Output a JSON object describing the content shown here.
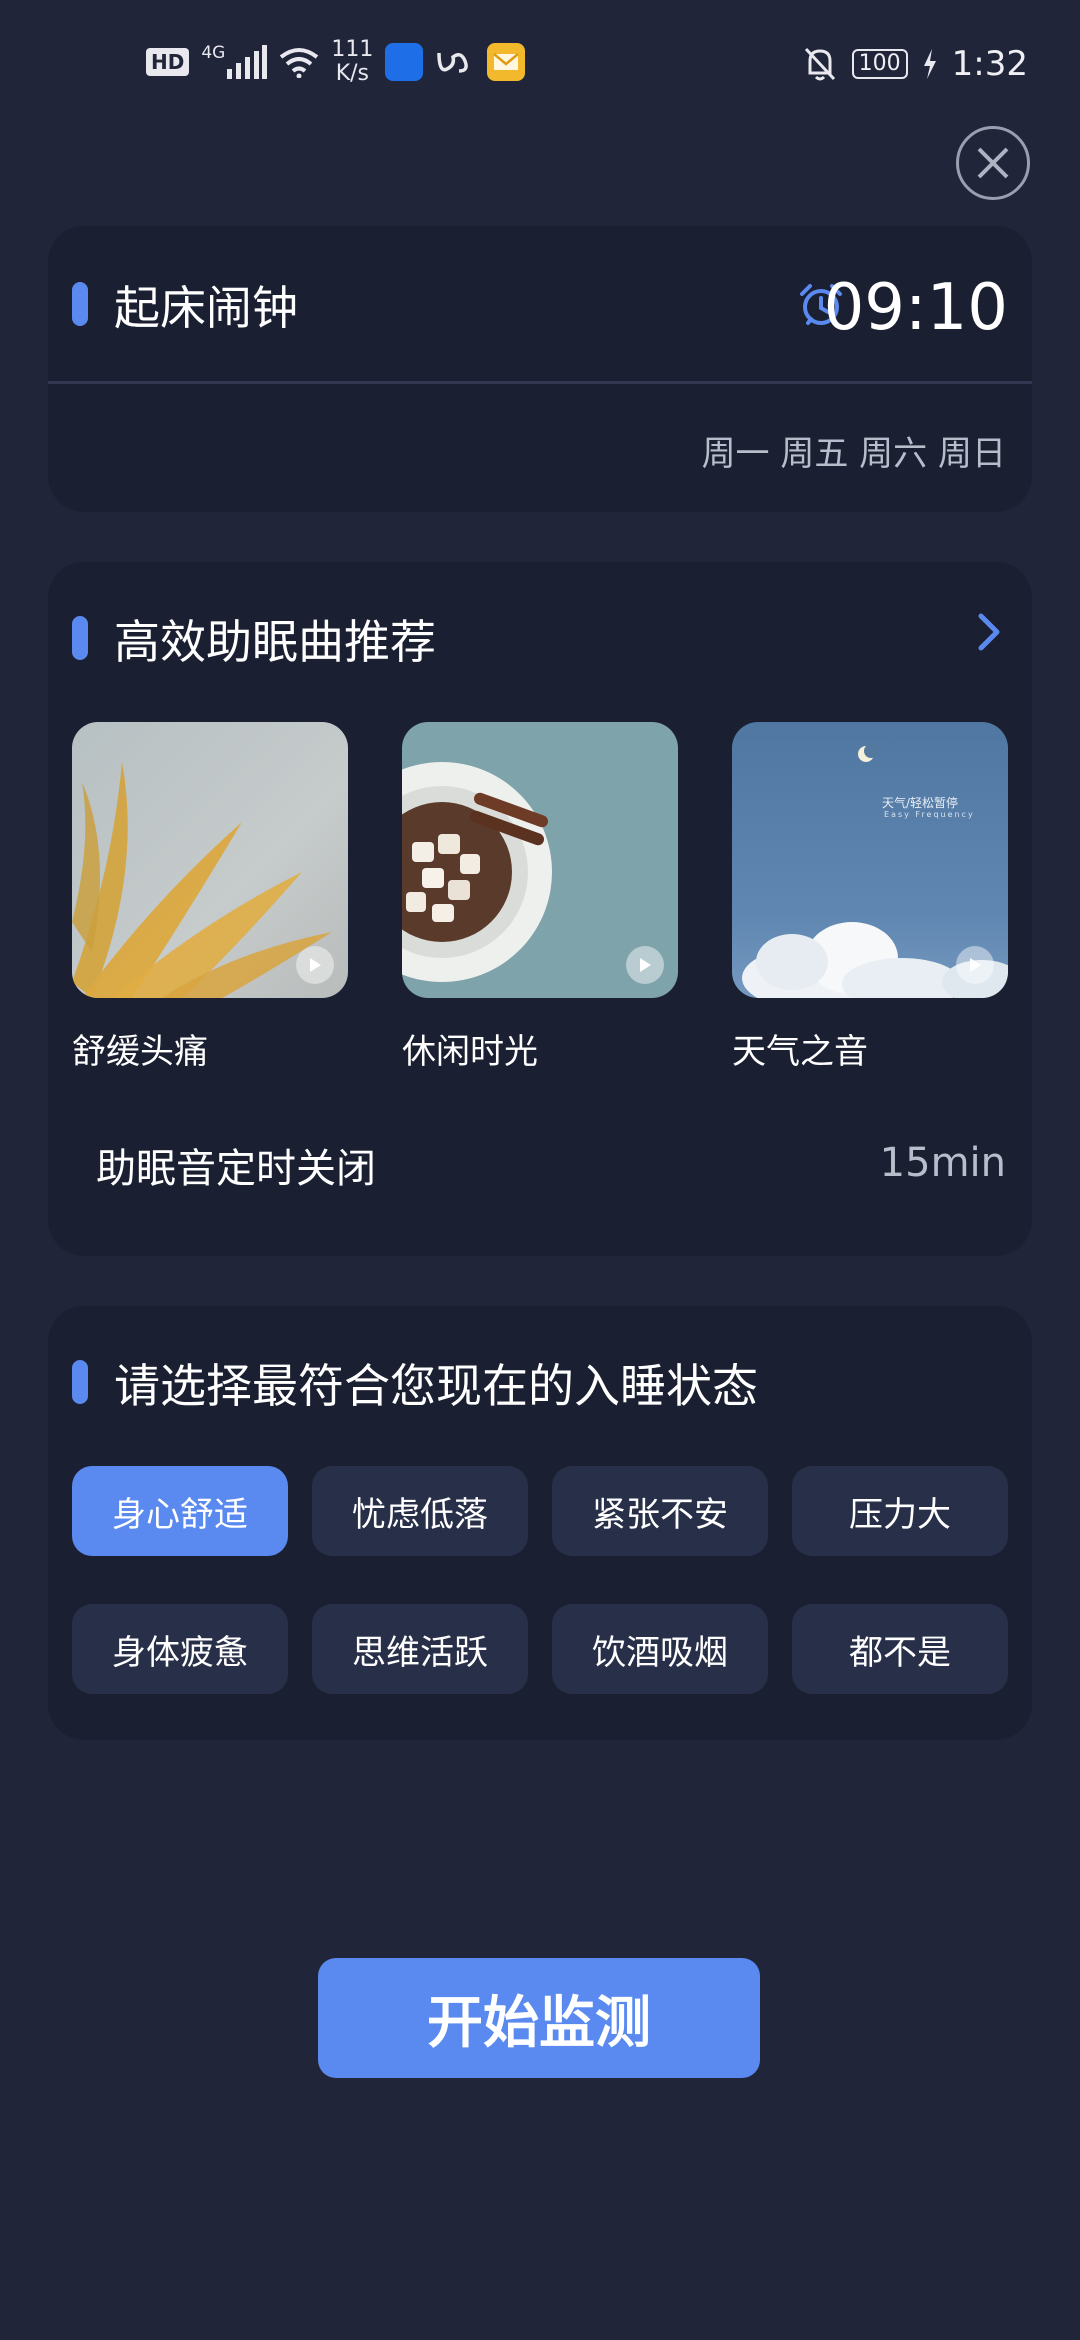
{
  "status_bar": {
    "hd": "HD",
    "network": "4G",
    "speed_value": "111",
    "speed_unit": "K/s",
    "battery": "100",
    "time": "1:32"
  },
  "alarm": {
    "title": "起床闹钟",
    "time": "09:10",
    "days": "周一 周五 周六 周日"
  },
  "music": {
    "title": "高效助眠曲推荐",
    "items": [
      {
        "label": "舒缓头痛"
      },
      {
        "label": "休闲时光"
      },
      {
        "label": "天气之音",
        "cover_text": "天气/轻松暂停",
        "cover_sub": "Easy Frequency"
      }
    ],
    "timer_label": "助眠音定时关闭",
    "timer_value": "15min"
  },
  "sleep_state": {
    "title": "请选择最符合您现在的入睡状态",
    "options": [
      "身心舒适",
      "忧虑低落",
      "紧张不安",
      "压力大",
      "身体疲惫",
      "思维活跃",
      "饮酒吸烟",
      "都不是"
    ],
    "selected": "身心舒适"
  },
  "start_button": "开始监测",
  "colors": {
    "background": "#20253a",
    "card": "#1a1f31",
    "accent": "#5a8af0",
    "chip": "#283049"
  }
}
